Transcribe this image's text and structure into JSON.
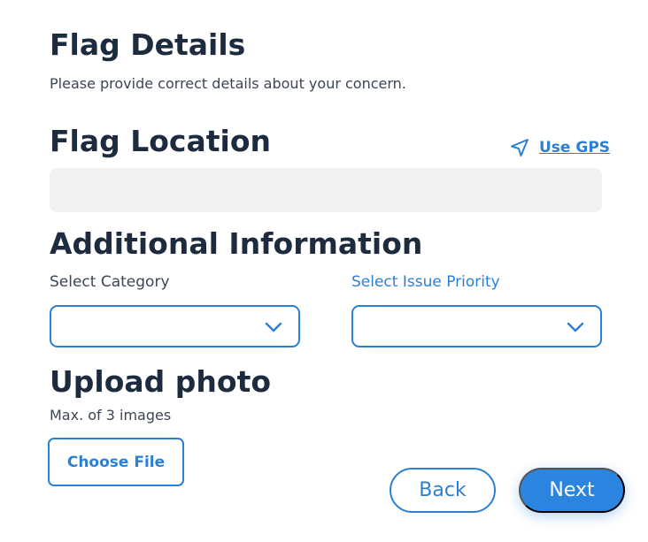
{
  "header": {
    "title": "Flag Details",
    "subtitle": "Please provide correct details about your concern."
  },
  "location": {
    "heading": "Flag Location",
    "use_gps_label": "Use GPS",
    "use_gps_icon": "navigation-arrow-icon",
    "input_value": ""
  },
  "additional": {
    "heading": "Additional Information",
    "category_label": "Select Category",
    "category_value": "",
    "priority_label": "Select Issue Priority",
    "priority_value": "",
    "dropdown_icon": "chevron-down-icon"
  },
  "upload": {
    "heading": "Upload photo",
    "subtitle": "Max. of 3 images",
    "choose_file_label": "Choose File"
  },
  "actions": {
    "back_label": "Back",
    "next_label": "Next"
  },
  "colors": {
    "accent": "#2b7fd4",
    "primary_button": "#2b84e0",
    "heading_text": "#1d2b3f",
    "input_background": "#f2f2f2"
  }
}
